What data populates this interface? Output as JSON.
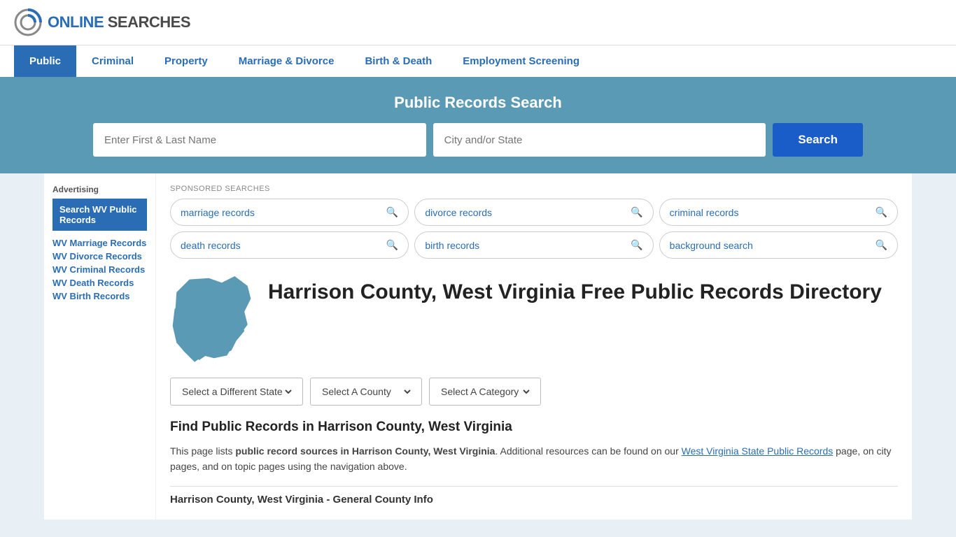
{
  "logo": {
    "text_online": "ONLINE",
    "text_searches": "SEARCHES"
  },
  "nav": {
    "items": [
      {
        "label": "Public",
        "active": true
      },
      {
        "label": "Criminal",
        "active": false
      },
      {
        "label": "Property",
        "active": false
      },
      {
        "label": "Marriage & Divorce",
        "active": false
      },
      {
        "label": "Birth & Death",
        "active": false
      },
      {
        "label": "Employment Screening",
        "active": false
      }
    ]
  },
  "search_banner": {
    "title": "Public Records Search",
    "name_placeholder": "Enter First & Last Name",
    "location_placeholder": "City and/or State",
    "search_button": "Search"
  },
  "sponsored": {
    "label": "SPONSORED SEARCHES",
    "pills": [
      {
        "label": "marriage records"
      },
      {
        "label": "divorce records"
      },
      {
        "label": "criminal records"
      },
      {
        "label": "death records"
      },
      {
        "label": "birth records"
      },
      {
        "label": "background search"
      }
    ]
  },
  "sidebar": {
    "ad_label": "Advertising",
    "ad_box": "Search WV Public Records",
    "links": [
      {
        "label": "WV Marriage Records"
      },
      {
        "label": "WV Divorce Records"
      },
      {
        "label": "WV Criminal Records"
      },
      {
        "label": "WV Death Records"
      },
      {
        "label": "WV Birth Records"
      }
    ]
  },
  "county": {
    "title": "Harrison County, West Virginia Free Public Records Directory",
    "dropdowns": {
      "state": "Select a Different State",
      "county": "Select A County",
      "category": "Select A Category"
    },
    "find_title": "Find Public Records in Harrison County, West Virginia",
    "description_part1": "This page lists ",
    "description_bold": "public record sources in Harrison County, West Virginia",
    "description_part2": ". Additional resources can be found on our ",
    "description_link": "West Virginia State Public Records",
    "description_part3": " page, on city pages, and on topic pages using the navigation above.",
    "general_info_title": "Harrison County, West Virginia - General County Info"
  }
}
